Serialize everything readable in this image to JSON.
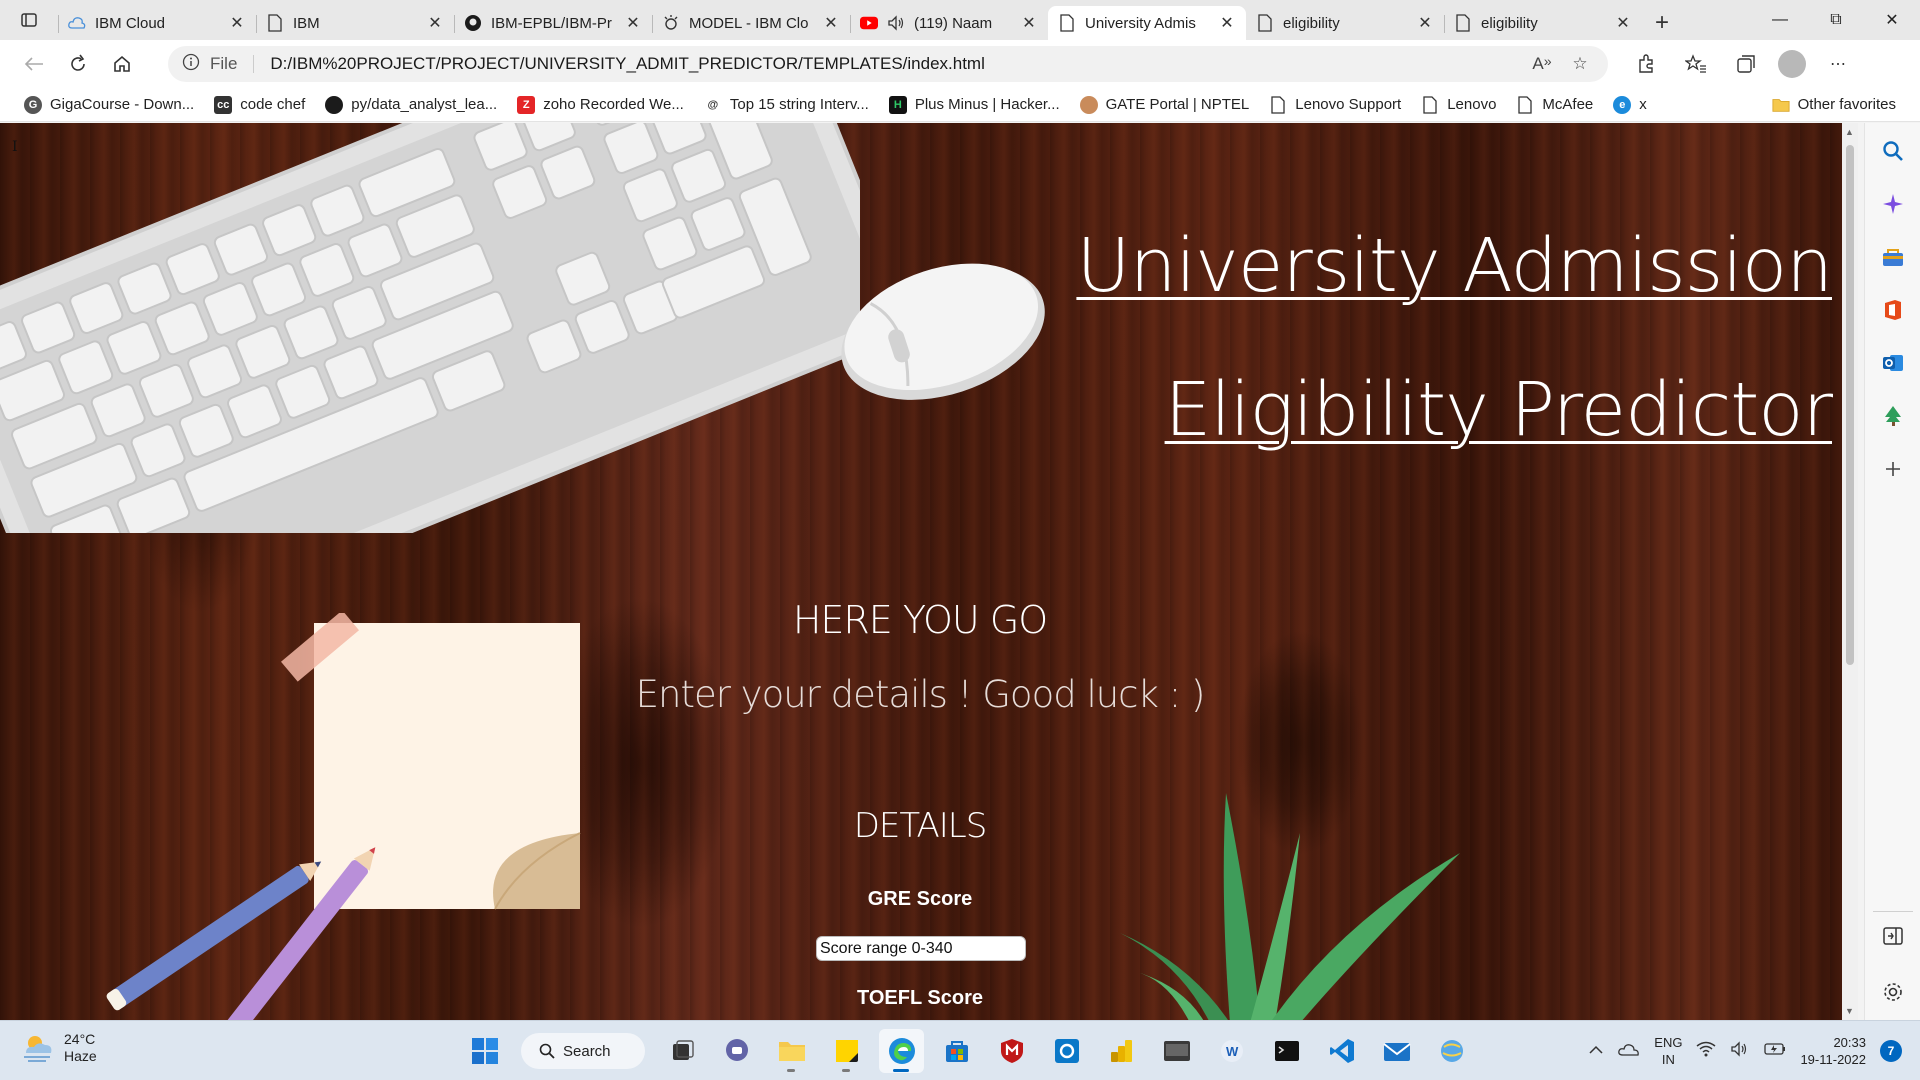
{
  "tabs": [
    {
      "title": "IBM Cloud",
      "icon": "cloud-icon"
    },
    {
      "title": "IBM",
      "icon": "page-icon"
    },
    {
      "title": "IBM-EPBL/IBM-Pr",
      "icon": "github-icon"
    },
    {
      "title": "MODEL - IBM Clo",
      "icon": "watson-icon"
    },
    {
      "title": "(119) Naam",
      "icon": "youtube-icon"
    },
    {
      "title": "University Admis",
      "icon": "page-icon",
      "active": true
    },
    {
      "title": "eligibility",
      "icon": "page-icon"
    },
    {
      "title": "eligibility",
      "icon": "page-icon"
    }
  ],
  "address": {
    "scheme_label": "File",
    "url": "D:/IBM%20PROJECT/PROJECT/UNIVERSITY_ADMIT_PREDICTOR/TEMPLATES/index.html"
  },
  "favorites": [
    {
      "label": "GigaCourse - Down...",
      "icon": "gigacourse-icon"
    },
    {
      "label": "code chef",
      "icon": "codechef-icon"
    },
    {
      "label": "py/data_analyst_lea...",
      "icon": "github-icon"
    },
    {
      "label": "zoho Recorded We...",
      "icon": "zoho-icon"
    },
    {
      "label": "Top 15 string Interv...",
      "icon": "web-icon"
    },
    {
      "label": "Plus Minus | Hacker...",
      "icon": "hackerrank-icon"
    },
    {
      "label": "GATE Portal | NPTEL",
      "icon": "nptel-icon"
    },
    {
      "label": "Lenovo Support",
      "icon": "page-icon"
    },
    {
      "label": "Lenovo",
      "icon": "page-icon"
    },
    {
      "label": "McAfee",
      "icon": "page-icon"
    },
    {
      "label": "x",
      "icon": "edge-icon"
    }
  ],
  "favorites_other": "Other favorites",
  "page": {
    "cursor_glyph": "I",
    "title_line1": "University Admission",
    "title_line2": "Eligibility Predictor",
    "here_heading": "HERE YOU GO",
    "subtitle": "Enter your details ! Good luck : )",
    "details_heading": "DETAILS",
    "gre_label": "GRE Score",
    "gre_placeholder": "Score range 0-340",
    "toefl_label": "TOEFL Score"
  },
  "taskbar": {
    "weather_temp": "24°C",
    "weather_desc": "Haze",
    "search_label": "Search",
    "lang_line1": "ENG",
    "lang_line2": "IN",
    "time": "20:33",
    "date": "19-11-2022",
    "notification_count": "7"
  },
  "colors": {
    "accent": "#0067c0",
    "wood_dark": "#3b160a",
    "wood_mid": "#5a2412",
    "title_text": "#ffffff"
  }
}
